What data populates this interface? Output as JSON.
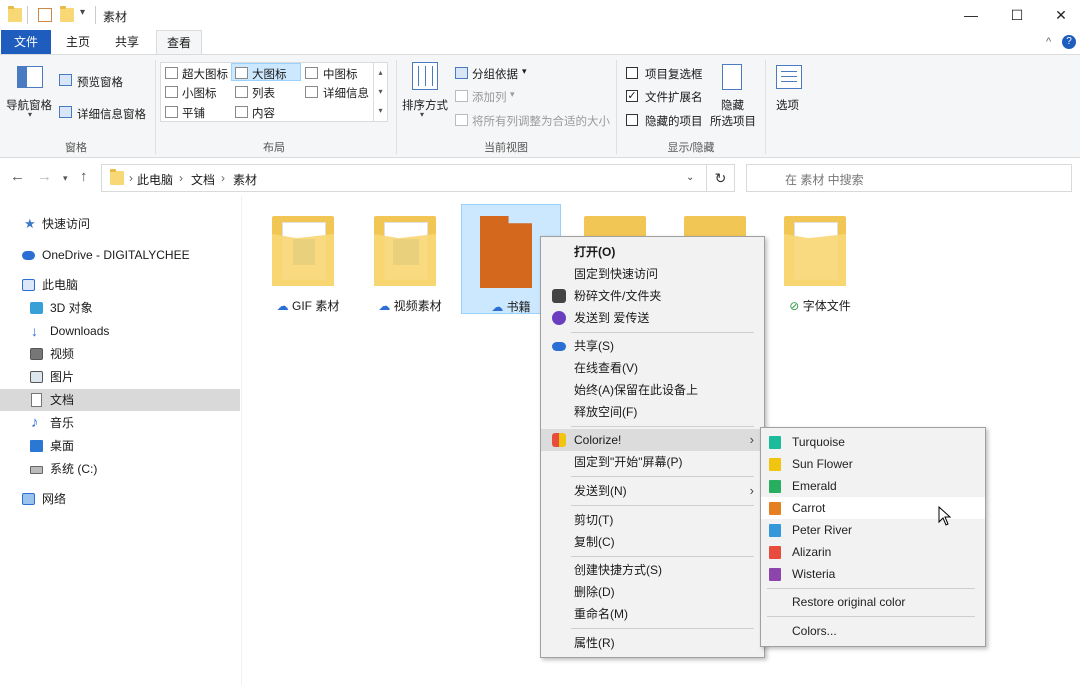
{
  "window": {
    "title": "素材",
    "minimize": "—",
    "maximize": "☐",
    "close": "✕",
    "help": "?",
    "collapse": "^"
  },
  "ribbon_tabs": [
    "文件",
    "主页",
    "共享",
    "查看"
  ],
  "ribbon": {
    "pane": {
      "nav_pane": "导航窗格",
      "preview_pane": "预览窗格",
      "details_pane": "详细信息窗格",
      "group": "窗格"
    },
    "layout": {
      "options": [
        "超大图标",
        "大图标",
        "中图标",
        "小图标",
        "列表",
        "详细信息",
        "平铺",
        "内容"
      ],
      "selected": "大图标",
      "group": "布局"
    },
    "current_view": {
      "sort_by": "排序方式",
      "group_by": "分组依据",
      "add_columns": "添加列",
      "size_all_columns": "将所有列调整为合适的大小",
      "group": "当前视图"
    },
    "show_hide": {
      "item_checkboxes": "项目复选框",
      "file_extensions": "文件扩展名",
      "hidden_items": "隐藏的项目",
      "hide_selected": "隐藏",
      "hide_selected_2": "所选项目",
      "group": "显示/隐藏",
      "checked": {
        "item_checkboxes": false,
        "file_extensions": true,
        "hidden_items": false
      }
    },
    "options": "选项"
  },
  "address": {
    "path": [
      "此电脑",
      "文档",
      "素材"
    ],
    "search_placeholder": "在 素材 中搜索"
  },
  "nav_pane": {
    "items": [
      "快速访问",
      "OneDrive - DIGITALYCHEE",
      "此电脑",
      "3D 对象",
      "Downloads",
      "视频",
      "图片",
      "文档",
      "音乐",
      "桌面",
      "系统 (C:)",
      "网络"
    ],
    "selected": "文档"
  },
  "files": [
    {
      "name": "GIF 素材",
      "status": "cloud"
    },
    {
      "name": "视频素材",
      "status": "cloud"
    },
    {
      "name": "书籍",
      "status": "cloud"
    },
    {
      "name": "",
      "status": ""
    },
    {
      "name": "",
      "status": ""
    },
    {
      "name": "字体文件",
      "status": "synced"
    }
  ],
  "context_menu": {
    "items": [
      "打开(O)",
      "固定到快速访问",
      "粉碎文件/文件夹",
      "发送到 爱传送",
      "共享(S)",
      "在线查看(V)",
      "始终(A)保留在此设备上",
      "释放空间(F)",
      "Colorize!",
      "固定到\"开始\"屏幕(P)",
      "发送到(N)",
      "剪切(T)",
      "复制(C)",
      "创建快捷方式(S)",
      "删除(D)",
      "重命名(M)",
      "属性(R)"
    ],
    "highlighted": "Colorize!"
  },
  "colorize_menu": {
    "colors": [
      {
        "name": "Turquoise",
        "color": "#1abc9c"
      },
      {
        "name": "Sun Flower",
        "color": "#f1c40f"
      },
      {
        "name": "Emerald",
        "color": "#27ae60"
      },
      {
        "name": "Carrot",
        "color": "#e67e22"
      },
      {
        "name": "Peter River",
        "color": "#3498db"
      },
      {
        "name": "Alizarin",
        "color": "#e74c3c"
      },
      {
        "name": "Wisteria",
        "color": "#8e44ad"
      }
    ],
    "restore": "Restore original color",
    "colors_more": "Colors...",
    "highlighted": "Carrot"
  },
  "accent": "#1e5dbd",
  "selected_folder_color": "#d4691e"
}
